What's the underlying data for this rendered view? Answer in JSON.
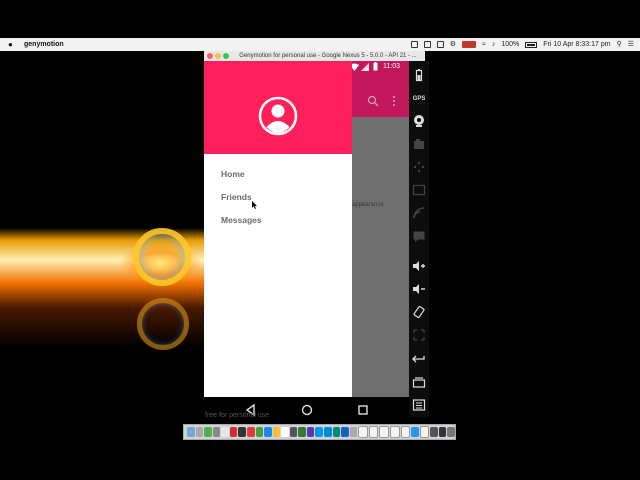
{
  "menubar": {
    "apple_icon": "apple-logo-icon",
    "app_name": "genymotion",
    "battery_percent": "100%",
    "datetime": "Fri 10 Apr  8:33:17 pm",
    "tray_icons": [
      "screen-share-icon",
      "display-icon",
      "settings-icon",
      "battery-icon",
      "recording-icon",
      "wifi-icon",
      "sound-icon"
    ]
  },
  "emulator": {
    "window_title": "Genymotion for personal use - Google Nexus 5 - 5.0.0 - API 21 - ...",
    "status_time": "11:03",
    "background_text": "appearance",
    "drawer": {
      "items": [
        {
          "label": "Home"
        },
        {
          "label": "Friends"
        },
        {
          "label": "Messages"
        }
      ]
    },
    "nav": {
      "back": "back-icon",
      "home": "home-icon",
      "recents": "recents-icon"
    },
    "watermark": "free for personal use",
    "colors": {
      "drawer_header": "#ff1f5a",
      "status_bar": "#c2185b",
      "menu_text": "#6b6b6b"
    }
  },
  "sidebar": {
    "tools": [
      "battery-icon",
      "gps-icon",
      "camera-icon",
      "capture-icon",
      "remote-control-icon",
      "id-icon",
      "network-icon",
      "sms-icon",
      "volume-up-icon",
      "volume-down-icon",
      "rotate-icon",
      "scale-icon",
      "back-icon",
      "recents-icon",
      "menu-icon"
    ],
    "gps_label": "GPS"
  }
}
